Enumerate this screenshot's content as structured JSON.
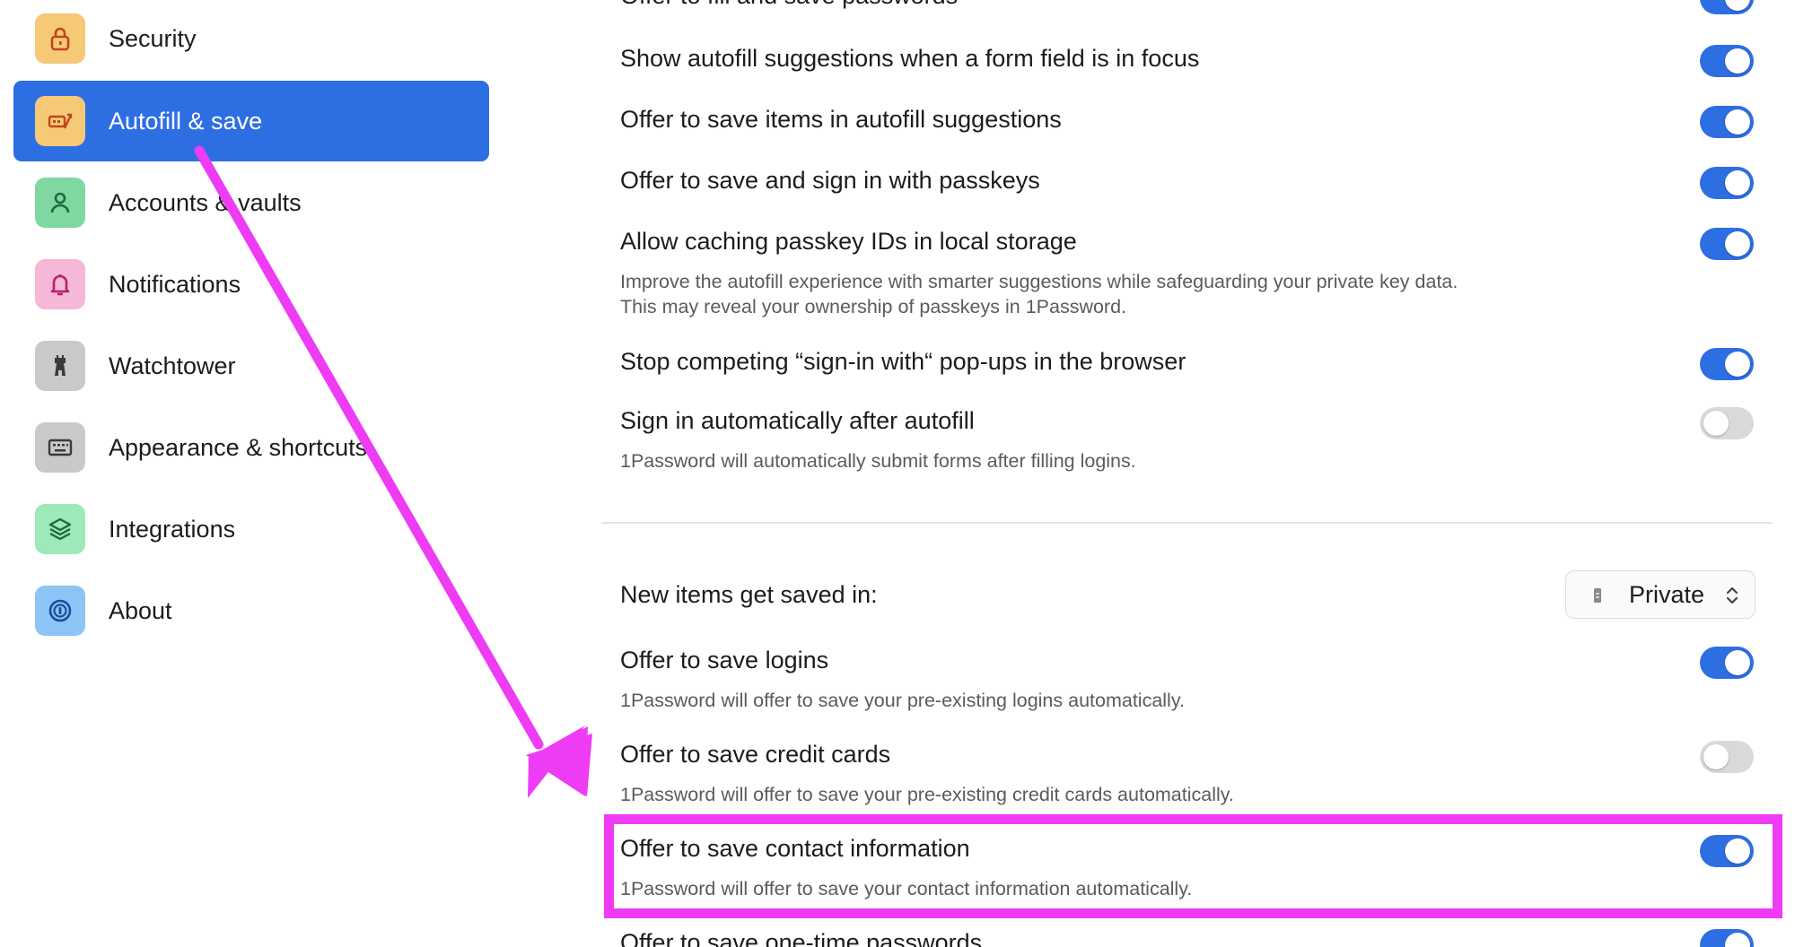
{
  "sidebar": {
    "items": [
      {
        "label": "Security",
        "icon": "lock-icon",
        "icon_bg": "#f6c977",
        "active": false
      },
      {
        "label": "Autofill & save",
        "icon": "autofill-icon",
        "icon_bg": "#f6c977",
        "active": true
      },
      {
        "label": "Accounts & vaults",
        "icon": "person-icon",
        "icon_bg": "#7fd8a2",
        "active": false
      },
      {
        "label": "Notifications",
        "icon": "bell-icon",
        "icon_bg": "#f5b8d6",
        "active": false
      },
      {
        "label": "Watchtower",
        "icon": "tower-icon",
        "icon_bg": "#c9c9c9",
        "active": false
      },
      {
        "label": "Appearance & shortcuts",
        "icon": "keyboard-icon",
        "icon_bg": "#c9c9c9",
        "active": false
      },
      {
        "label": "Integrations",
        "icon": "integrations-icon",
        "icon_bg": "#9ee8b9",
        "active": false
      },
      {
        "label": "About",
        "icon": "onepassword-icon",
        "icon_bg": "#8cc4f5",
        "active": false
      }
    ]
  },
  "settings": {
    "fill_save_passwords": {
      "title": "Offer to fill and save passwords",
      "enabled": true
    },
    "show_suggestions": {
      "title": "Show autofill suggestions when a form field is in focus",
      "enabled": true
    },
    "save_in_suggestions": {
      "title": "Offer to save items in autofill suggestions",
      "enabled": true
    },
    "passkeys": {
      "title": "Offer to save and sign in with passkeys",
      "enabled": true
    },
    "caching_passkeys": {
      "title": "Allow caching passkey IDs in local storage",
      "desc_line1": "Improve the autofill experience with smarter suggestions while safeguarding your private key data.",
      "desc_line2": "This may reveal your ownership of passkeys in 1Password.",
      "enabled": true
    },
    "stop_popups": {
      "title": "Stop competing “sign-in with“ pop-ups in the browser",
      "enabled": true
    },
    "sign_in_auto": {
      "title": "Sign in automatically after autofill",
      "desc": "1Password will automatically submit forms after filling logins.",
      "enabled": false
    },
    "new_items_saved_in": {
      "title": "New items get saved in:",
      "selected_vault": "Private"
    },
    "save_logins": {
      "title": "Offer to save logins",
      "desc": "1Password will offer to save your pre-existing logins automatically.",
      "enabled": true
    },
    "save_credit_cards": {
      "title": "Offer to save credit cards",
      "desc": "1Password will offer to save your pre-existing credit cards automatically.",
      "enabled": false
    },
    "save_contact_info": {
      "title": "Offer to save contact information",
      "desc": "1Password will offer to save your contact information automatically.",
      "enabled": true
    },
    "save_otp": {
      "title": "Offer to save one-time passwords",
      "enabled": true
    }
  },
  "colors": {
    "accent": "#2e6ee3",
    "toggle_off": "#d9d9d9",
    "annotation": "#ee3cf5"
  }
}
